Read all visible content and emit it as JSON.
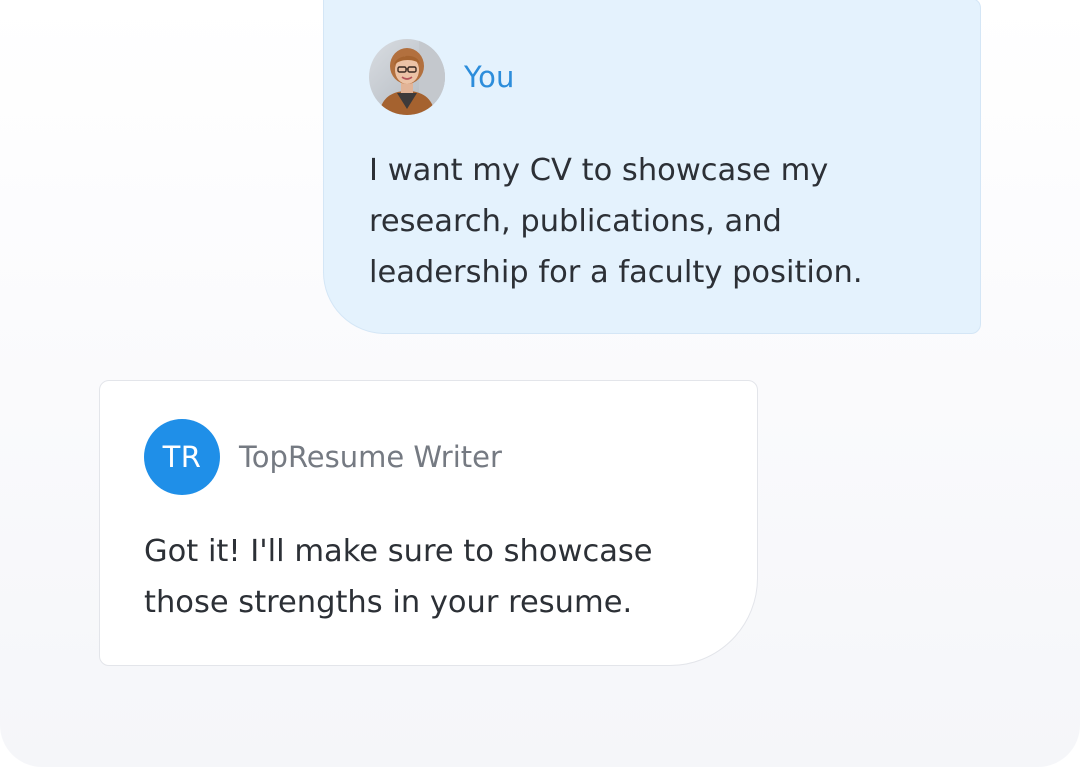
{
  "messages": [
    {
      "sender": "You",
      "avatar": "user-photo",
      "text": "I want my CV to showcase my research, publications, and leadership for a faculty position."
    },
    {
      "sender": "TopResume Writer",
      "avatar_initials": "TR",
      "text": "Got it! I'll make sure to showcase those strengths in your resume."
    }
  ],
  "colors": {
    "user_bubble": "#e4f2fd",
    "user_name": "#2c8ddb",
    "writer_avatar": "#1f8fe8",
    "writer_name": "#757a82",
    "message_text": "#2c3036"
  }
}
